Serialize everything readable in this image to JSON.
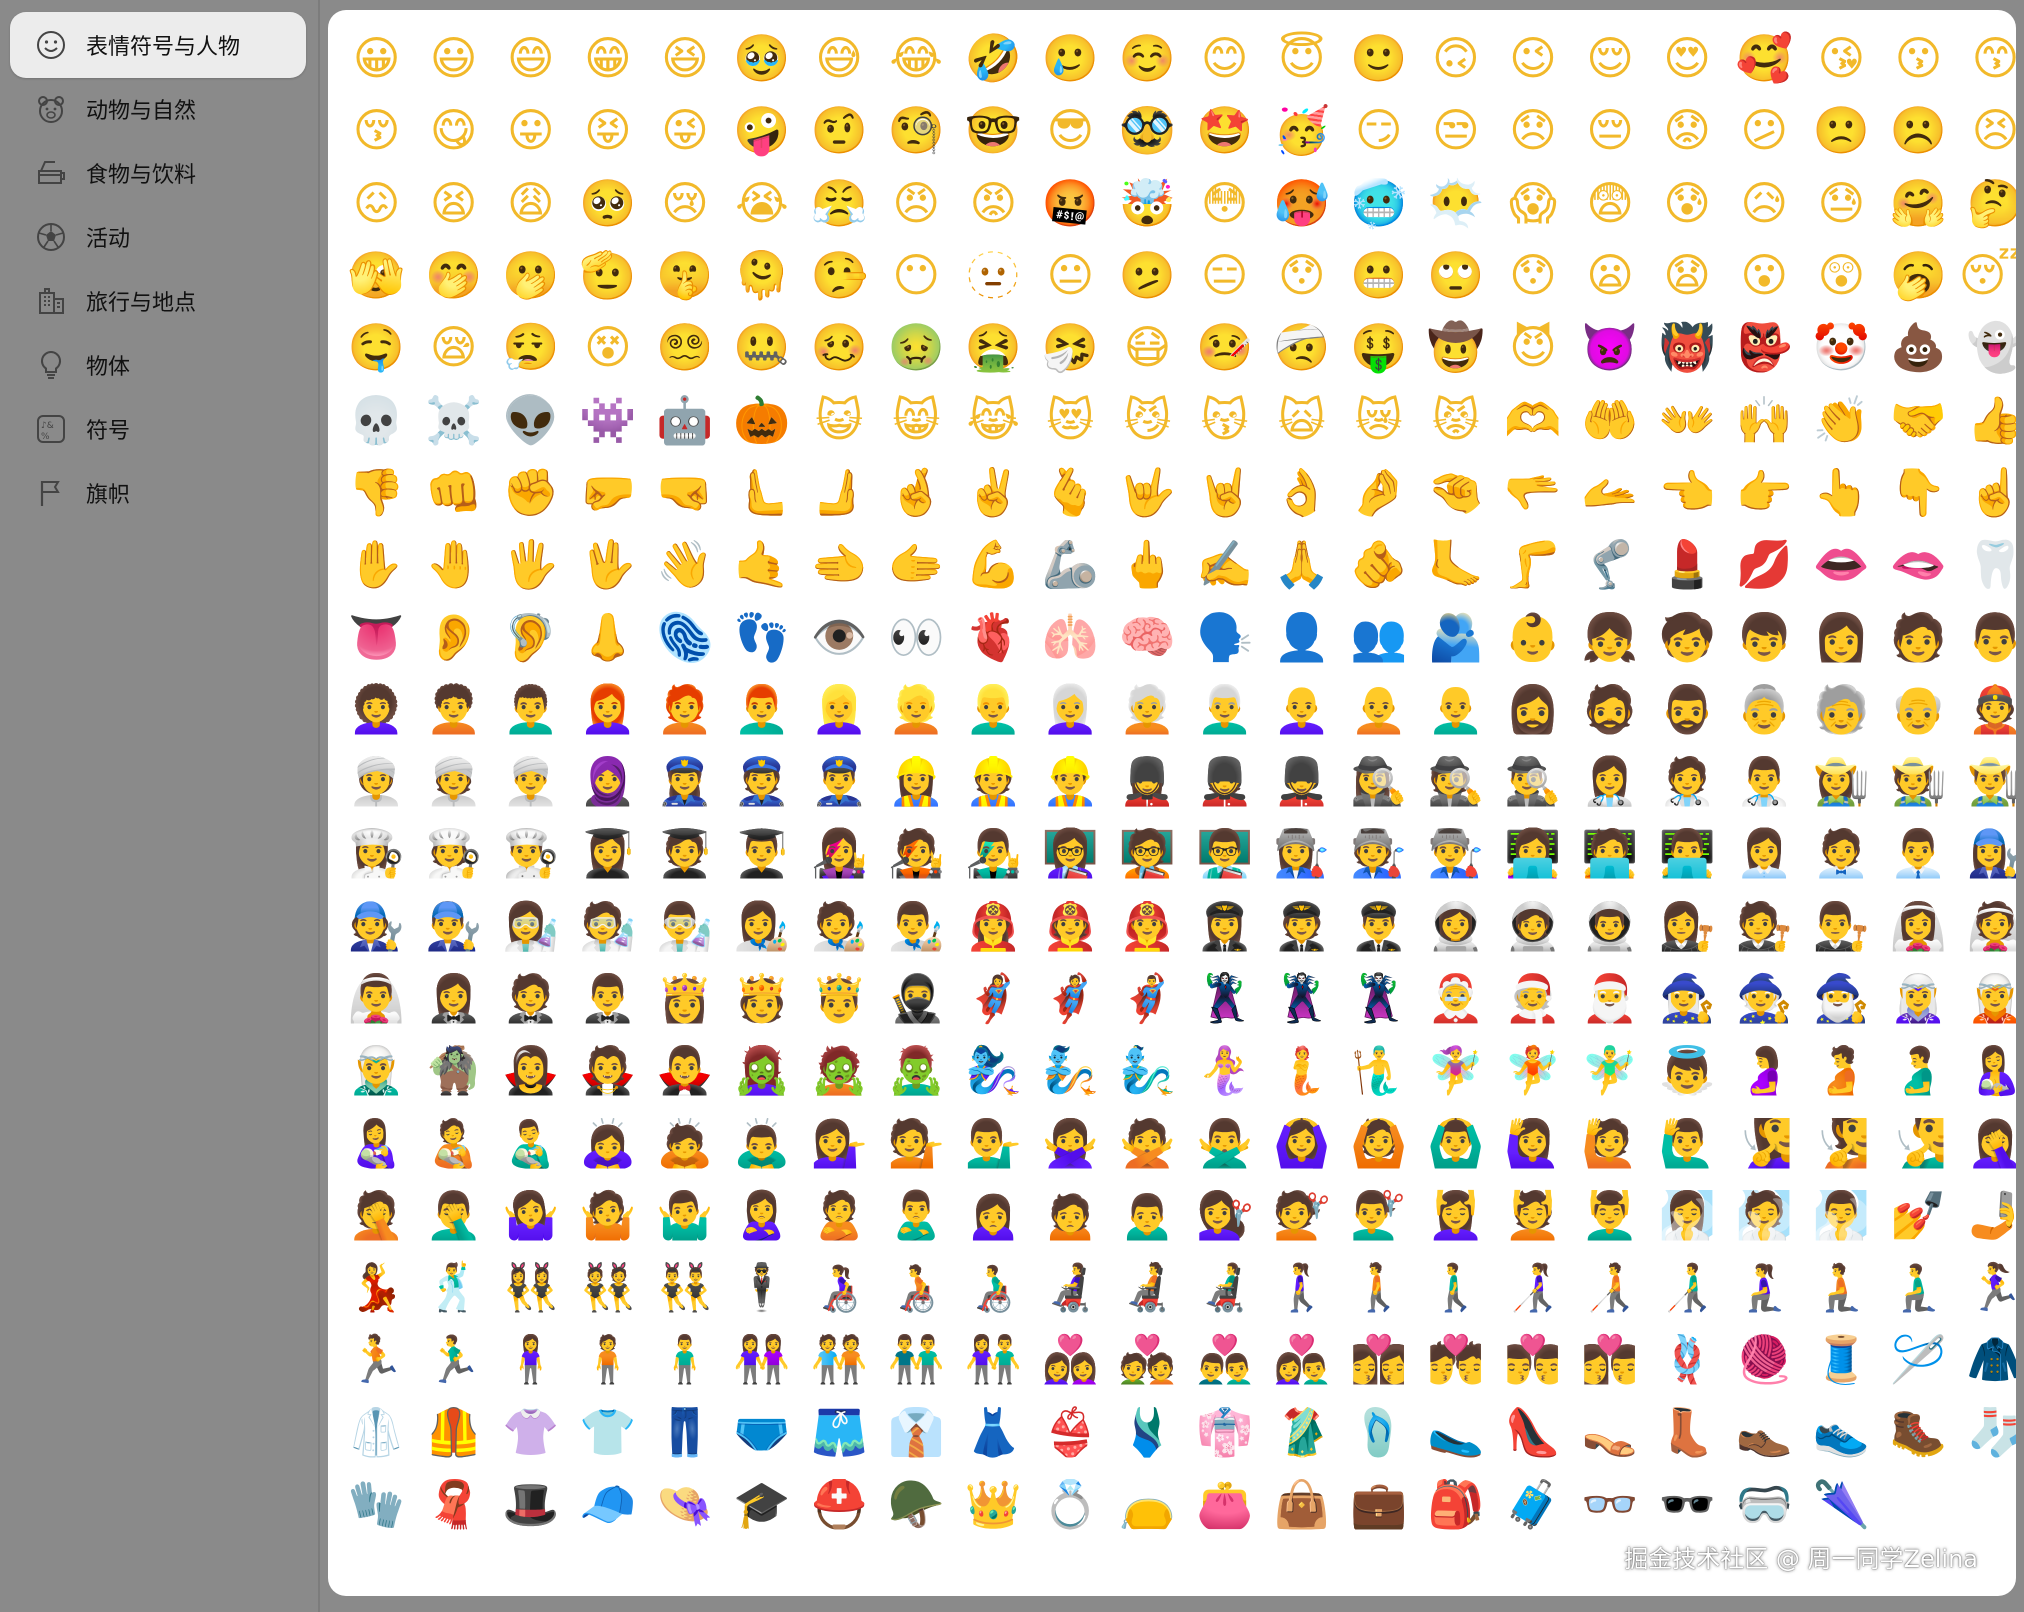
{
  "sidebar": {
    "categories": [
      {
        "label": "表情符号与人物",
        "icon": "smiley-icon",
        "active": true
      },
      {
        "label": "动物与自然",
        "icon": "bear-icon",
        "active": false
      },
      {
        "label": "食物与饮料",
        "icon": "food-icon",
        "active": false
      },
      {
        "label": "活动",
        "icon": "soccer-ball-icon",
        "active": false
      },
      {
        "label": "旅行与地点",
        "icon": "building-icon",
        "active": false
      },
      {
        "label": "物体",
        "icon": "lightbulb-icon",
        "active": false
      },
      {
        "label": "符号",
        "icon": "symbols-icon",
        "active": false
      },
      {
        "label": "旗帜",
        "icon": "flag-icon",
        "active": false
      }
    ]
  },
  "emoji_grid": {
    "columns": 22,
    "items": [
      "😀",
      "😃",
      "😄",
      "😁",
      "😆",
      "🥹",
      "😅",
      "😂",
      "🤣",
      "🥲",
      "☺️",
      "😊",
      "😇",
      "🙂",
      "🙃",
      "😉",
      "😌",
      "😍",
      "🥰",
      "😘",
      "😗",
      "😙",
      "😚",
      "😋",
      "😛",
      "😝",
      "😜",
      "🤪",
      "🤨",
      "🧐",
      "🤓",
      "😎",
      "🥸",
      "🤩",
      "🥳",
      "😏",
      "😒",
      "😞",
      "😔",
      "😟",
      "😕",
      "🙁",
      "☹️",
      "😣",
      "😖",
      "😫",
      "😩",
      "🥺",
      "😢",
      "😭",
      "😤",
      "😠",
      "😡",
      "🤬",
      "🤯",
      "😳",
      "🥵",
      "🥶",
      "😶‍🌫️",
      "😱",
      "😨",
      "😰",
      "😥",
      "😓",
      "🤗",
      "🤔",
      "🫣",
      "🤭",
      "🫢",
      "🫡",
      "🤫",
      "🫠",
      "🤥",
      "😶",
      "🫥",
      "😐",
      "🫤",
      "😑",
      "😯",
      "😬",
      "🙄",
      "😯",
      "😦",
      "😧",
      "😮",
      "😲",
      "🥱",
      "😴",
      "🤤",
      "😪",
      "😮‍💨",
      "😵",
      "😵‍💫",
      "🤐",
      "🥴",
      "🤢",
      "🤮",
      "🤧",
      "😷",
      "🤒",
      "🤕",
      "🤑",
      "🤠",
      "😈",
      "👿",
      "👹",
      "👺",
      "🤡",
      "💩",
      "👻",
      "💀",
      "☠️",
      "👽",
      "👾",
      "🤖",
      "🎃",
      "😺",
      "😸",
      "😹",
      "😻",
      "😼",
      "😽",
      "🙀",
      "😿",
      "😾",
      "🫶",
      "🤲",
      "👐",
      "🙌",
      "👏",
      "🤝",
      "👍",
      "👎",
      "👊",
      "✊",
      "🤛",
      "🤜",
      "🫷",
      "🫸",
      "🤞",
      "✌️",
      "🫰",
      "🤟",
      "🤘",
      "👌",
      "🤌",
      "🤏",
      "🫳",
      "🫴",
      "👈",
      "👉",
      "👆",
      "👇",
      "☝️",
      "✋",
      "🤚",
      "🖐️",
      "🖖",
      "👋",
      "🤙",
      "🫲",
      "🫱",
      "💪",
      "🦾",
      "🖕",
      "✍️",
      "🙏",
      "🫵",
      "🦶",
      "🦵",
      "🦿",
      "💄",
      "💋",
      "👄",
      "🫦",
      "🦷",
      "👅",
      "👂",
      "🦻",
      "👃",
      "🫆",
      "👣",
      "👁️",
      "👀",
      "🫀",
      "🫁",
      "🧠",
      "🗣️",
      "👤",
      "👥",
      "🫂",
      "👶",
      "👧",
      "🧒",
      "👦",
      "👩",
      "🧑",
      "👨",
      "👩‍🦱",
      "🧑‍🦱",
      "👨‍🦱",
      "👩‍🦰",
      "🧑‍🦰",
      "👨‍🦰",
      "👱‍♀️",
      "👱",
      "👱‍♂️",
      "👩‍🦳",
      "🧑‍🦳",
      "👨‍🦳",
      "👩‍🦲",
      "🧑‍🦲",
      "👨‍🦲",
      "🧔‍♀️",
      "🧔",
      "🧔‍♂️",
      "👵",
      "🧓",
      "👴",
      "👲",
      "👳‍♀️",
      "👳",
      "👳‍♂️",
      "🧕",
      "👮‍♀️",
      "👮",
      "👮‍♂️",
      "👷‍♀️",
      "👷",
      "👷‍♂️",
      "💂‍♀️",
      "💂",
      "💂‍♂️",
      "🕵️‍♀️",
      "🕵️",
      "🕵️‍♂️",
      "👩‍⚕️",
      "🧑‍⚕️",
      "👨‍⚕️",
      "👩‍🌾",
      "🧑‍🌾",
      "👨‍🌾",
      "👩‍🍳",
      "🧑‍🍳",
      "👨‍🍳",
      "👩‍🎓",
      "🧑‍🎓",
      "👨‍🎓",
      "👩‍🎤",
      "🧑‍🎤",
      "👨‍🎤",
      "👩‍🏫",
      "🧑‍🏫",
      "👨‍🏫",
      "👩‍🏭",
      "🧑‍🏭",
      "👨‍🏭",
      "👩‍💻",
      "🧑‍💻",
      "👨‍💻",
      "👩‍💼",
      "🧑‍💼",
      "👨‍💼",
      "👩‍🔧",
      "🧑‍🔧",
      "👨‍🔧",
      "👩‍🔬",
      "🧑‍🔬",
      "👨‍🔬",
      "👩‍🎨",
      "🧑‍🎨",
      "👨‍🎨",
      "👩‍🚒",
      "🧑‍🚒",
      "👨‍🚒",
      "👩‍✈️",
      "🧑‍✈️",
      "👨‍✈️",
      "👩‍🚀",
      "🧑‍🚀",
      "👨‍🚀",
      "👩‍⚖️",
      "🧑‍⚖️",
      "👨‍⚖️",
      "👰‍♀️",
      "👰",
      "👰‍♂️",
      "🤵‍♀️",
      "🤵",
      "🤵‍♂️",
      "👸",
      "🫅",
      "🤴",
      "🥷",
      "🦸‍♀️",
      "🦸",
      "🦸‍♂️",
      "🦹‍♀️",
      "🦹",
      "🦹‍♂️",
      "🤶",
      "🧑‍🎄",
      "🎅",
      "🧙‍♀️",
      "🧙",
      "🧙‍♂️",
      "🧝‍♀️",
      "🧝",
      "🧝‍♂️",
      "🧌",
      "🧛‍♀️",
      "🧛",
      "🧛‍♂️",
      "🧟‍♀️",
      "🧟",
      "🧟‍♂️",
      "🧞‍♀️",
      "🧞",
      "🧞‍♂️",
      "🧜‍♀️",
      "🧜",
      "🧜‍♂️",
      "🧚‍♀️",
      "🧚",
      "🧚‍♂️",
      "👼",
      "🤰",
      "🫄",
      "🫃",
      "🤱",
      "👩‍🍼",
      "🧑‍🍼",
      "👨‍🍼",
      "🙇‍♀️",
      "🙇",
      "🙇‍♂️",
      "💁‍♀️",
      "💁",
      "💁‍♂️",
      "🙅‍♀️",
      "🙅",
      "🙅‍♂️",
      "🙆‍♀️",
      "🙆",
      "🙆‍♂️",
      "🙋‍♀️",
      "🙋",
      "🙋‍♂️",
      "🧏‍♀️",
      "🧏",
      "🧏‍♂️",
      "🤦‍♀️",
      "🤦",
      "🤦‍♂️",
      "🤷‍♀️",
      "🤷",
      "🤷‍♂️",
      "🙎‍♀️",
      "🙎",
      "🙎‍♂️",
      "🙍‍♀️",
      "🙍",
      "🙍‍♂️",
      "💇‍♀️",
      "💇",
      "💇‍♂️",
      "💆‍♀️",
      "💆",
      "💆‍♂️",
      "🧖‍♀️",
      "🧖",
      "🧖‍♂️",
      "💅",
      "🤳",
      "💃",
      "🕺",
      "👯‍♀️",
      "👯",
      "👯‍♂️",
      "🕴️",
      "👩‍🦽",
      "🧑‍🦽",
      "👨‍🦽",
      "👩‍🦼",
      "🧑‍🦼",
      "👨‍🦼",
      "🚶‍♀️",
      "🚶",
      "🚶‍♂️",
      "👩‍🦯",
      "🧑‍🦯",
      "👨‍🦯",
      "🧎‍♀️",
      "🧎",
      "🧎‍♂️",
      "🏃‍♀️",
      "🏃",
      "🏃‍♂️",
      "🧍‍♀️",
      "🧍",
      "🧍‍♂️",
      "👭",
      "🧑‍🤝‍🧑",
      "👬",
      "👫",
      "👩‍❤️‍👩",
      "💑",
      "👨‍❤️‍👨",
      "👩‍❤️‍👨",
      "👩‍❤️‍💋‍👩",
      "💏",
      "👨‍❤️‍💋‍👨",
      "👩‍❤️‍💋‍👨",
      "🪢",
      "🧶",
      "🧵",
      "🪡",
      "🧥",
      "🥼",
      "🦺",
      "👚",
      "👕",
      "👖",
      "🩲",
      "🩳",
      "👔",
      "👗",
      "👙",
      "🩱",
      "👘",
      "🥻",
      "🩴",
      "🥿",
      "👠",
      "👡",
      "👢",
      "👞",
      "👟",
      "🥾",
      "🧦",
      "🧤",
      "🧣",
      "🎩",
      "🧢",
      "👒",
      "🎓",
      "⛑️",
      "🪖",
      "👑",
      "💍",
      "👝",
      "👛",
      "👜",
      "💼",
      "🎒",
      "🧳",
      "👓",
      "🕶️",
      "🥽",
      "🌂"
    ]
  },
  "watermark": {
    "text": "掘金技术社区 @ 周一同学Zelina"
  }
}
